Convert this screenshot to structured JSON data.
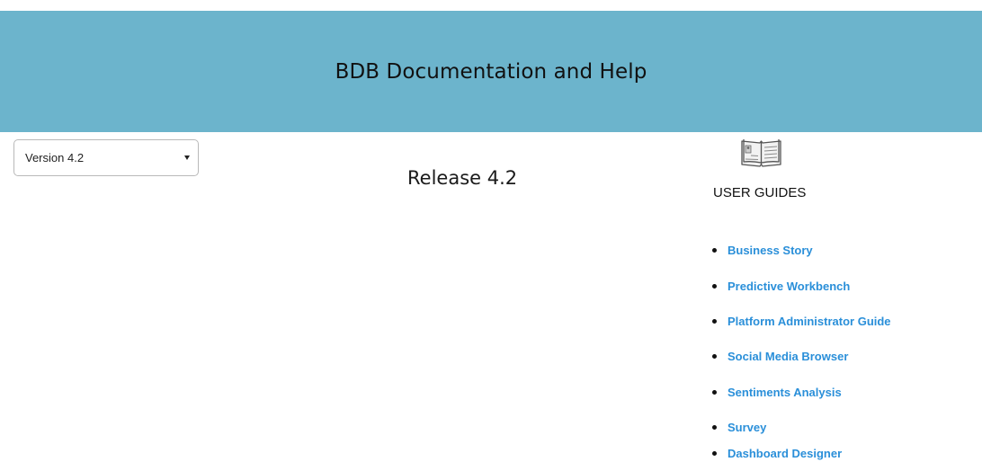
{
  "header": {
    "title": "BDB Documentation and Help"
  },
  "version_select": {
    "selected": "Version 4.2"
  },
  "main": {
    "release_title": "Release 4.2"
  },
  "user_guides": {
    "icon": "open-book-icon",
    "heading": "USER GUIDES",
    "items": [
      {
        "label": "Business Story"
      },
      {
        "label": "Predictive Workbench"
      },
      {
        "label": "Platform Administrator Guide"
      },
      {
        "label": "Social Media Browser"
      },
      {
        "label": "Sentiments Analysis"
      },
      {
        "label": "Survey"
      },
      {
        "label": "Dashboard Designer"
      }
    ]
  },
  "colors": {
    "banner": "#6cb4cc",
    "link": "#2a8fd9"
  }
}
